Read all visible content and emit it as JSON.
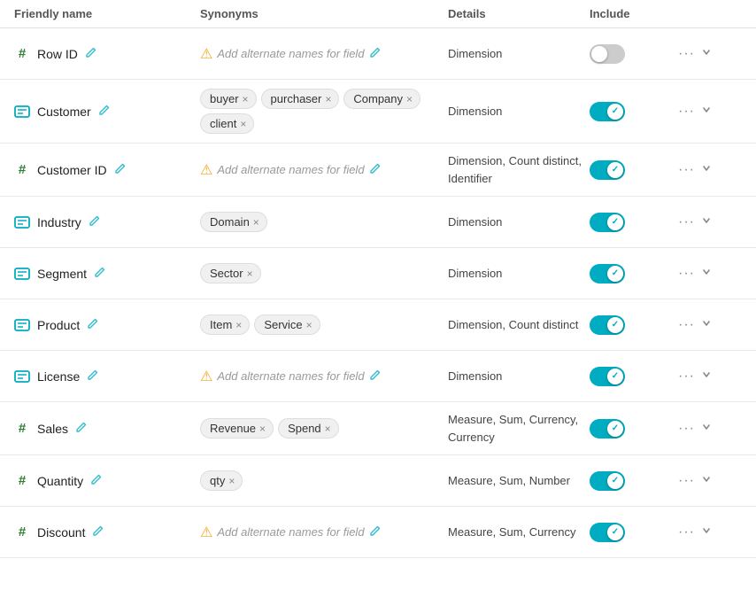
{
  "header": {
    "columns": [
      {
        "id": "friendly-name",
        "label": "Friendly name"
      },
      {
        "id": "synonyms",
        "label": "Synonyms"
      },
      {
        "id": "details",
        "label": "Details"
      },
      {
        "id": "include",
        "label": "Include"
      },
      {
        "id": "actions",
        "label": ""
      }
    ]
  },
  "rows": [
    {
      "id": "row-id",
      "icon": "hash",
      "name": "Row ID",
      "synonyms": [],
      "addSynonymPlaceholder": "Add alternate names for field",
      "details": "Dimension",
      "included": false
    },
    {
      "id": "customer",
      "icon": "text",
      "name": "Customer",
      "synonyms": [
        "buyer",
        "purchaser",
        "Company",
        "client"
      ],
      "addSynonymPlaceholder": null,
      "details": "Dimension",
      "included": true
    },
    {
      "id": "customer-id",
      "icon": "hash",
      "name": "Customer ID",
      "synonyms": [],
      "addSynonymPlaceholder": "Add alternate names for field",
      "details": "Dimension,\nCount distinct,\nIdentifier",
      "included": true
    },
    {
      "id": "industry",
      "icon": "text",
      "name": "Industry",
      "synonyms": [
        "Domain"
      ],
      "addSynonymPlaceholder": null,
      "details": "Dimension",
      "included": true
    },
    {
      "id": "segment",
      "icon": "text",
      "name": "Segment",
      "synonyms": [
        "Sector"
      ],
      "addSynonymPlaceholder": null,
      "details": "Dimension",
      "included": true
    },
    {
      "id": "product",
      "icon": "text",
      "name": "Product",
      "synonyms": [
        "Item",
        "Service"
      ],
      "addSynonymPlaceholder": null,
      "details": "Dimension,\nCount distinct",
      "included": true
    },
    {
      "id": "license",
      "icon": "text",
      "name": "License",
      "synonyms": [],
      "addSynonymPlaceholder": "Add alternate names for field",
      "details": "Dimension",
      "included": true
    },
    {
      "id": "sales",
      "icon": "hash",
      "name": "Sales",
      "synonyms": [
        "Revenue",
        "Spend"
      ],
      "addSynonymPlaceholder": null,
      "details": "Measure, Sum,\nCurrency,\nCurrency",
      "included": true
    },
    {
      "id": "quantity",
      "icon": "hash",
      "name": "Quantity",
      "synonyms": [
        "qty"
      ],
      "addSynonymPlaceholder": null,
      "details": "Measure, Sum,\nNumber",
      "included": true
    },
    {
      "id": "discount",
      "icon": "hash",
      "name": "Discount",
      "synonyms": [],
      "addSynonymPlaceholder": "Add alternate names for field",
      "details": "Measure, Sum,\nCurrency",
      "included": true
    }
  ],
  "labels": {
    "edit": "✎",
    "close": "×",
    "more": "•••",
    "chevron": "›",
    "check": "✓",
    "warning": "⚠",
    "hash": "#",
    "text": "⊓"
  }
}
